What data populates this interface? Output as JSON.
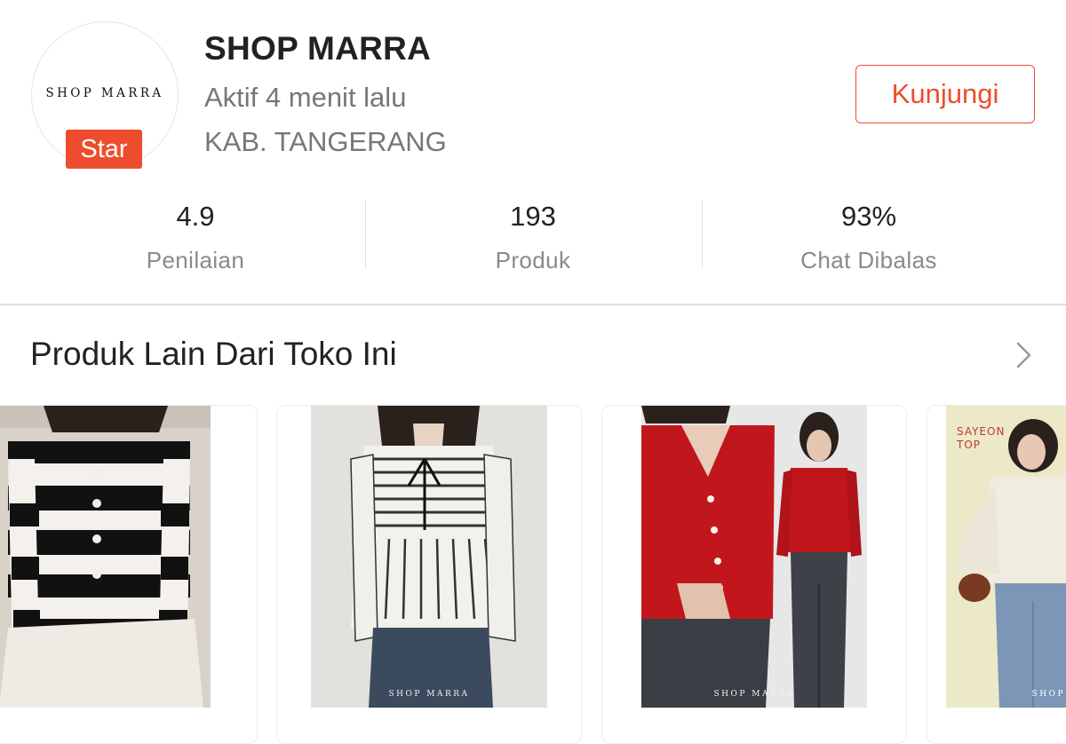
{
  "shop": {
    "logo_text": "SHOP MARRA",
    "badge": "Star",
    "name": "SHOP MARRA",
    "active": "Aktif 4 menit lalu",
    "location": "KAB. TANGERANG",
    "visit_label": "Kunjungi"
  },
  "stats": [
    {
      "value": "4.9",
      "label": "Penilaian"
    },
    {
      "value": "193",
      "label": "Produk"
    },
    {
      "value": "93%",
      "label": "Chat Dibalas"
    }
  ],
  "section": {
    "title": "Produk Lain Dari Toko Ini",
    "more_icon": "chevron-right-icon"
  },
  "products": [
    {
      "image": "black-white-striped-fuzzy-cardigan"
    },
    {
      "image": "striped-peplum-top-with-tie",
      "watermark": "SHOP MARRA"
    },
    {
      "image": "red-knit-cardigan-pearl-buttons",
      "watermark": "SHOP MARRA"
    },
    {
      "image": "white-lace-sayeon-top",
      "overlay_text": "SAYEON TOP",
      "watermark": "SHOP"
    }
  ],
  "colors": {
    "accent": "#ee4d2d",
    "muted_text": "#777777",
    "divider": "#dedede"
  }
}
